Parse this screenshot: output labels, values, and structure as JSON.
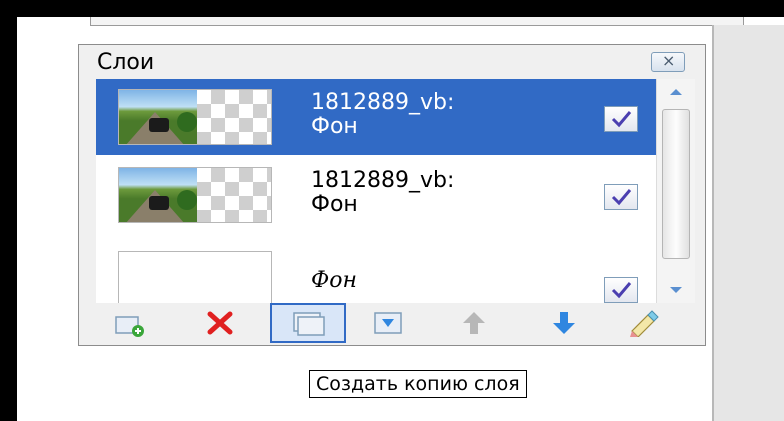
{
  "panel": {
    "title": "Слои",
    "close_glyph": "×"
  },
  "layers": [
    {
      "name": "1812889_vb:\nФон",
      "selected": true,
      "visible": true,
      "thumbnail": "road-scene-thumbnail"
    },
    {
      "name": "1812889_vb:\nФон",
      "selected": false,
      "visible": true,
      "thumbnail": "road-scene-thumbnail"
    },
    {
      "name": "Фон",
      "selected": false,
      "visible": true,
      "thumbnail": "blank-white-thumbnail"
    }
  ],
  "toolbar": {
    "tools": [
      {
        "name": "add-layer",
        "icon": "add-layer-icon"
      },
      {
        "name": "delete-layer",
        "icon": "delete-x-icon"
      },
      {
        "name": "duplicate-layer",
        "icon": "duplicate-layer-icon",
        "active": true
      },
      {
        "name": "merge-down",
        "icon": "merge-down-icon"
      },
      {
        "name": "move-up",
        "icon": "arrow-up-icon"
      },
      {
        "name": "move-down",
        "icon": "arrow-down-icon"
      },
      {
        "name": "layer-properties",
        "icon": "properties-pencil-icon"
      }
    ]
  },
  "tooltip": {
    "text": "Создать копию слоя"
  },
  "colors": {
    "selection": "#316ac5",
    "delete_red": "#e02020",
    "arrow_blue": "#2f86e0",
    "arrow_gray": "#b7b7b7"
  }
}
